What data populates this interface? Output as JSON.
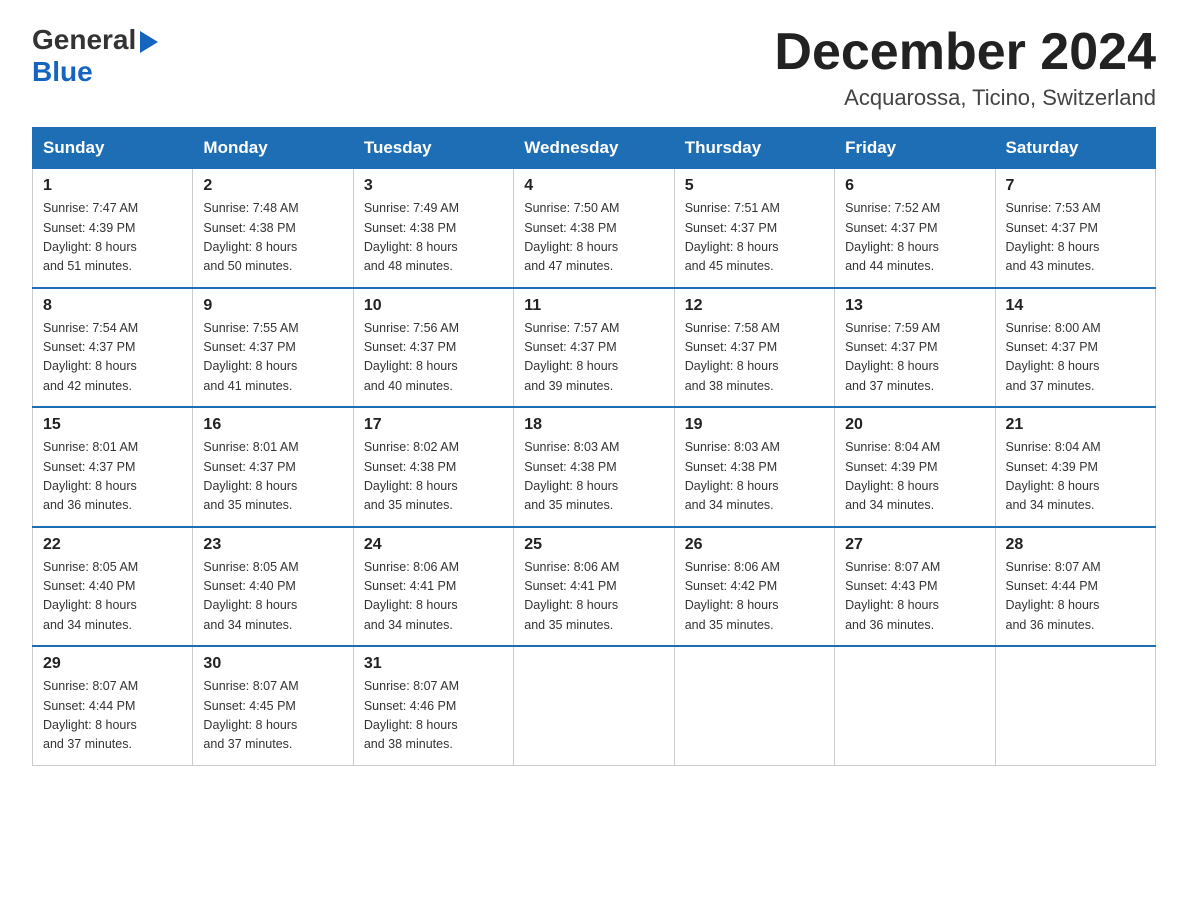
{
  "header": {
    "logo": {
      "general": "General",
      "blue": "Blue"
    },
    "title": "December 2024",
    "location": "Acquarossa, Ticino, Switzerland"
  },
  "days_of_week": [
    "Sunday",
    "Monday",
    "Tuesday",
    "Wednesday",
    "Thursday",
    "Friday",
    "Saturday"
  ],
  "weeks": [
    [
      {
        "day": "1",
        "sunrise": "7:47 AM",
        "sunset": "4:39 PM",
        "daylight": "8 hours and 51 minutes."
      },
      {
        "day": "2",
        "sunrise": "7:48 AM",
        "sunset": "4:38 PM",
        "daylight": "8 hours and 50 minutes."
      },
      {
        "day": "3",
        "sunrise": "7:49 AM",
        "sunset": "4:38 PM",
        "daylight": "8 hours and 48 minutes."
      },
      {
        "day": "4",
        "sunrise": "7:50 AM",
        "sunset": "4:38 PM",
        "daylight": "8 hours and 47 minutes."
      },
      {
        "day": "5",
        "sunrise": "7:51 AM",
        "sunset": "4:37 PM",
        "daylight": "8 hours and 45 minutes."
      },
      {
        "day": "6",
        "sunrise": "7:52 AM",
        "sunset": "4:37 PM",
        "daylight": "8 hours and 44 minutes."
      },
      {
        "day": "7",
        "sunrise": "7:53 AM",
        "sunset": "4:37 PM",
        "daylight": "8 hours and 43 minutes."
      }
    ],
    [
      {
        "day": "8",
        "sunrise": "7:54 AM",
        "sunset": "4:37 PM",
        "daylight": "8 hours and 42 minutes."
      },
      {
        "day": "9",
        "sunrise": "7:55 AM",
        "sunset": "4:37 PM",
        "daylight": "8 hours and 41 minutes."
      },
      {
        "day": "10",
        "sunrise": "7:56 AM",
        "sunset": "4:37 PM",
        "daylight": "8 hours and 40 minutes."
      },
      {
        "day": "11",
        "sunrise": "7:57 AM",
        "sunset": "4:37 PM",
        "daylight": "8 hours and 39 minutes."
      },
      {
        "day": "12",
        "sunrise": "7:58 AM",
        "sunset": "4:37 PM",
        "daylight": "8 hours and 38 minutes."
      },
      {
        "day": "13",
        "sunrise": "7:59 AM",
        "sunset": "4:37 PM",
        "daylight": "8 hours and 37 minutes."
      },
      {
        "day": "14",
        "sunrise": "8:00 AM",
        "sunset": "4:37 PM",
        "daylight": "8 hours and 37 minutes."
      }
    ],
    [
      {
        "day": "15",
        "sunrise": "8:01 AM",
        "sunset": "4:37 PM",
        "daylight": "8 hours and 36 minutes."
      },
      {
        "day": "16",
        "sunrise": "8:01 AM",
        "sunset": "4:37 PM",
        "daylight": "8 hours and 35 minutes."
      },
      {
        "day": "17",
        "sunrise": "8:02 AM",
        "sunset": "4:38 PM",
        "daylight": "8 hours and 35 minutes."
      },
      {
        "day": "18",
        "sunrise": "8:03 AM",
        "sunset": "4:38 PM",
        "daylight": "8 hours and 35 minutes."
      },
      {
        "day": "19",
        "sunrise": "8:03 AM",
        "sunset": "4:38 PM",
        "daylight": "8 hours and 34 minutes."
      },
      {
        "day": "20",
        "sunrise": "8:04 AM",
        "sunset": "4:39 PM",
        "daylight": "8 hours and 34 minutes."
      },
      {
        "day": "21",
        "sunrise": "8:04 AM",
        "sunset": "4:39 PM",
        "daylight": "8 hours and 34 minutes."
      }
    ],
    [
      {
        "day": "22",
        "sunrise": "8:05 AM",
        "sunset": "4:40 PM",
        "daylight": "8 hours and 34 minutes."
      },
      {
        "day": "23",
        "sunrise": "8:05 AM",
        "sunset": "4:40 PM",
        "daylight": "8 hours and 34 minutes."
      },
      {
        "day": "24",
        "sunrise": "8:06 AM",
        "sunset": "4:41 PM",
        "daylight": "8 hours and 34 minutes."
      },
      {
        "day": "25",
        "sunrise": "8:06 AM",
        "sunset": "4:41 PM",
        "daylight": "8 hours and 35 minutes."
      },
      {
        "day": "26",
        "sunrise": "8:06 AM",
        "sunset": "4:42 PM",
        "daylight": "8 hours and 35 minutes."
      },
      {
        "day": "27",
        "sunrise": "8:07 AM",
        "sunset": "4:43 PM",
        "daylight": "8 hours and 36 minutes."
      },
      {
        "day": "28",
        "sunrise": "8:07 AM",
        "sunset": "4:44 PM",
        "daylight": "8 hours and 36 minutes."
      }
    ],
    [
      {
        "day": "29",
        "sunrise": "8:07 AM",
        "sunset": "4:44 PM",
        "daylight": "8 hours and 37 minutes."
      },
      {
        "day": "30",
        "sunrise": "8:07 AM",
        "sunset": "4:45 PM",
        "daylight": "8 hours and 37 minutes."
      },
      {
        "day": "31",
        "sunrise": "8:07 AM",
        "sunset": "4:46 PM",
        "daylight": "8 hours and 38 minutes."
      },
      null,
      null,
      null,
      null
    ]
  ],
  "labels": {
    "sunrise": "Sunrise:",
    "sunset": "Sunset:",
    "daylight": "Daylight:"
  }
}
